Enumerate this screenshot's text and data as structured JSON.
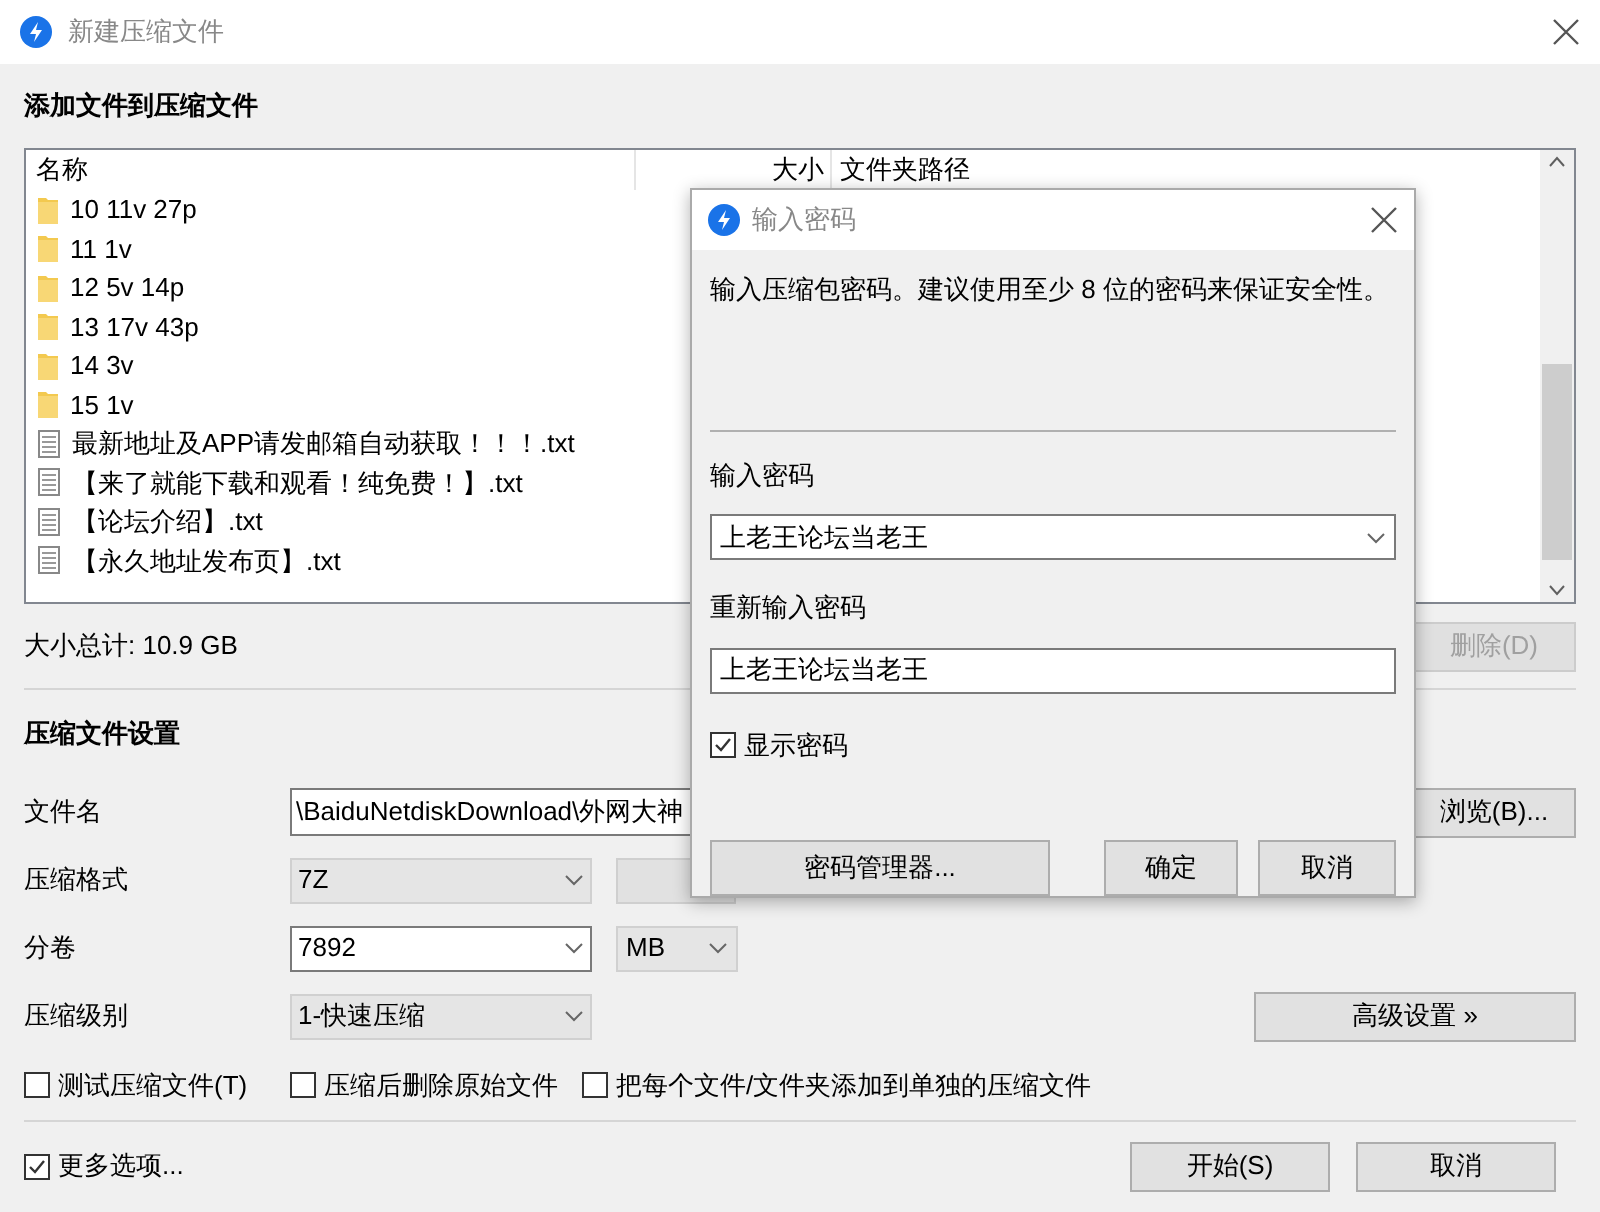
{
  "window": {
    "title": "新建压缩文件"
  },
  "files": {
    "heading": "添加文件到压缩文件",
    "columns": [
      "名称",
      "大小",
      "文件夹路径"
    ],
    "rows": [
      {
        "name": "10 11v 27p",
        "kind": "folder"
      },
      {
        "name": "11 1v",
        "kind": "folder"
      },
      {
        "name": "12 5v 14p",
        "kind": "folder"
      },
      {
        "name": "13 17v 43p",
        "kind": "folder"
      },
      {
        "name": "14 3v",
        "kind": "folder"
      },
      {
        "name": "15 1v",
        "kind": "folder"
      },
      {
        "name": "最新地址及APP请发邮箱自动获取！！！.txt",
        "kind": "file"
      },
      {
        "name": "【来了就能下载和观看！纯免费！】.txt",
        "kind": "file"
      },
      {
        "name": "【论坛介绍】.txt",
        "kind": "file"
      },
      {
        "name": "【永久地址发布页】.txt",
        "kind": "file"
      }
    ],
    "total": "大小总计: 10.9 GB",
    "delete_button": {
      "label": "删除(D)",
      "disabled": true
    }
  },
  "settings": {
    "heading": "压缩文件设置",
    "filename": {
      "label": "文件名",
      "value": "\\BaiduNetdiskDownload\\外网大神"
    },
    "browse_button": "浏览(B)...",
    "format": {
      "label": "压缩格式",
      "value": "7Z",
      "disabled": true
    },
    "split": {
      "label": "分卷",
      "value": "7892",
      "unit": "MB",
      "disabled": false
    },
    "level": {
      "label": "压缩级别",
      "value": "1-快速压缩",
      "disabled": true
    },
    "advanced_button": "高级设置 »",
    "options": [
      {
        "label": "测试压缩文件(T)",
        "checked": false
      },
      {
        "label": "压缩后删除原始文件",
        "checked": false
      },
      {
        "label": "把每个文件/文件夹添加到单独的压缩文件",
        "checked": false
      }
    ]
  },
  "more_options": {
    "label": "更多选项...",
    "checked": true
  },
  "buttons": [
    "开始(S)",
    "取消"
  ],
  "dialog": {
    "title": "输入密码",
    "message": "输入压缩包密码。建议使用至少 8 位的密码来保证安全性。",
    "password_label": "输入密码",
    "password": "上老王论坛当老王",
    "confirm_label": "重新输入密码",
    "confirm": "上老王论坛当老王",
    "show_password": {
      "label": "显示密码",
      "checked": true
    },
    "buttons": [
      "密码管理器...",
      "确定",
      "取消"
    ]
  }
}
